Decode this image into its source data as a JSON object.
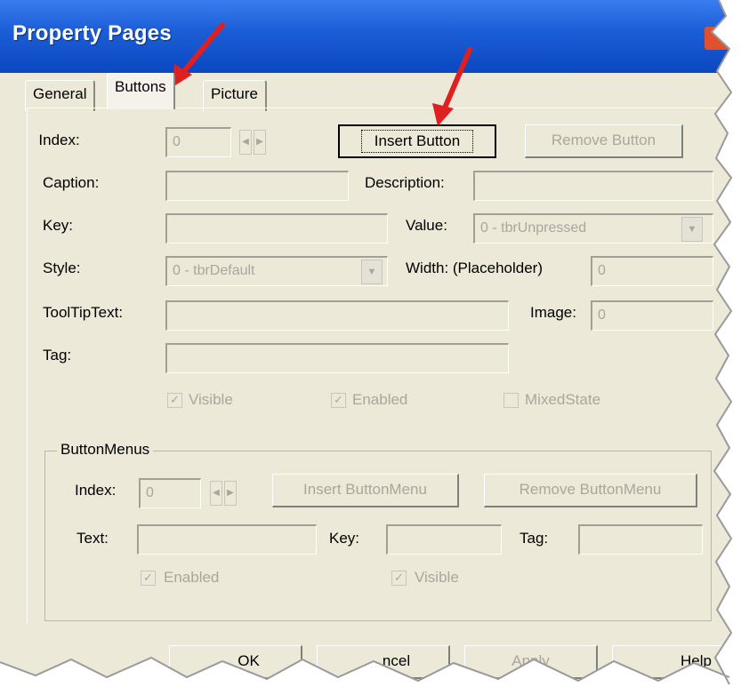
{
  "window": {
    "title": "Property Pages"
  },
  "tabs": [
    {
      "label": "General"
    },
    {
      "label": "Buttons"
    },
    {
      "label": "Picture"
    }
  ],
  "buttons_tab": {
    "index_label": "Index:",
    "index_value": "0",
    "insert_button": "Insert Button",
    "remove_button": "Remove Button",
    "caption_label": "Caption:",
    "caption_value": "",
    "description_label": "Description:",
    "description_value": "",
    "key_label": "Key:",
    "key_value": "",
    "value_label": "Value:",
    "value_value": "0 - tbrUnpressed",
    "style_label": "Style:",
    "style_value": "0 - tbrDefault",
    "width_label": "Width: (Placeholder)",
    "width_value": "0",
    "tooltip_label": "ToolTipText:",
    "tooltip_value": "",
    "image_label": "Image:",
    "image_value": "0",
    "tag_label": "Tag:",
    "tag_value": "",
    "visible_label": "Visible",
    "enabled_label": "Enabled",
    "mixedstate_label": "MixedState",
    "visible_checked": true,
    "enabled_checked": true,
    "mixedstate_checked": false
  },
  "button_menus": {
    "group_label": "ButtonMenus",
    "index_label": "Index:",
    "index_value": "0",
    "insert_label": "Insert ButtonMenu",
    "remove_label": "Remove ButtonMenu",
    "text_label": "Text:",
    "text_value": "",
    "key_label": "Key:",
    "key_value": "",
    "tag_label": "Tag:",
    "tag_value": "",
    "enabled_label": "Enabled",
    "visible_label": "Visible",
    "enabled_checked": true,
    "visible_checked": true
  },
  "footer": {
    "ok": "OK",
    "cancel": "ncel",
    "apply": "Apply",
    "help": "Help"
  }
}
